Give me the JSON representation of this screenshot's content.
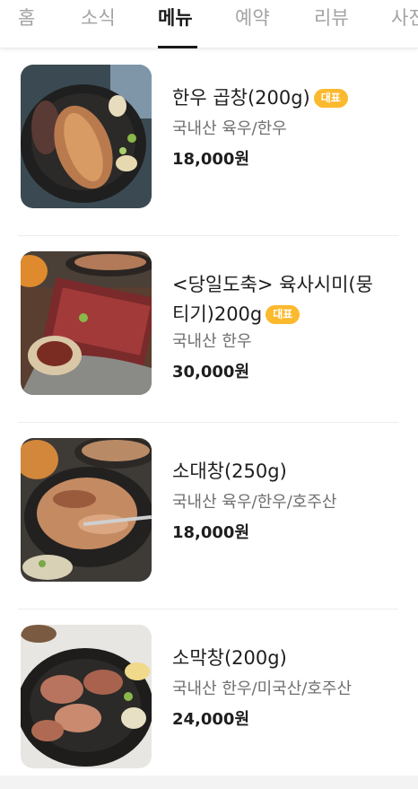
{
  "tabs": [
    {
      "label": "홈"
    },
    {
      "label": "소식"
    },
    {
      "label": "메뉴"
    },
    {
      "label": "예약"
    },
    {
      "label": "리뷰"
    },
    {
      "label": "사진"
    }
  ],
  "active_tab": "메뉴",
  "menu": [
    {
      "name": "한우 곱창(200g)",
      "badge": "대표",
      "origin": "국내산 육우/한우",
      "price": "18,000원"
    },
    {
      "name_line1": "<당일도축> 육사시미(뭉",
      "name_line2": "티기)200g",
      "badge": "대표",
      "origin": "국내산 한우",
      "price": "30,000원"
    },
    {
      "name": "소대창(250g)",
      "origin": "국내산 육우/한우/호주산",
      "price": "18,000원"
    },
    {
      "name": "소막창(200g)",
      "origin": "국내산 한우/미국산/호주산",
      "price": "24,000원"
    }
  ],
  "colors": {
    "badge": "#fbb92e",
    "active_tab": "#1a1a1a",
    "inactive_tab": "#a3a3a3"
  }
}
